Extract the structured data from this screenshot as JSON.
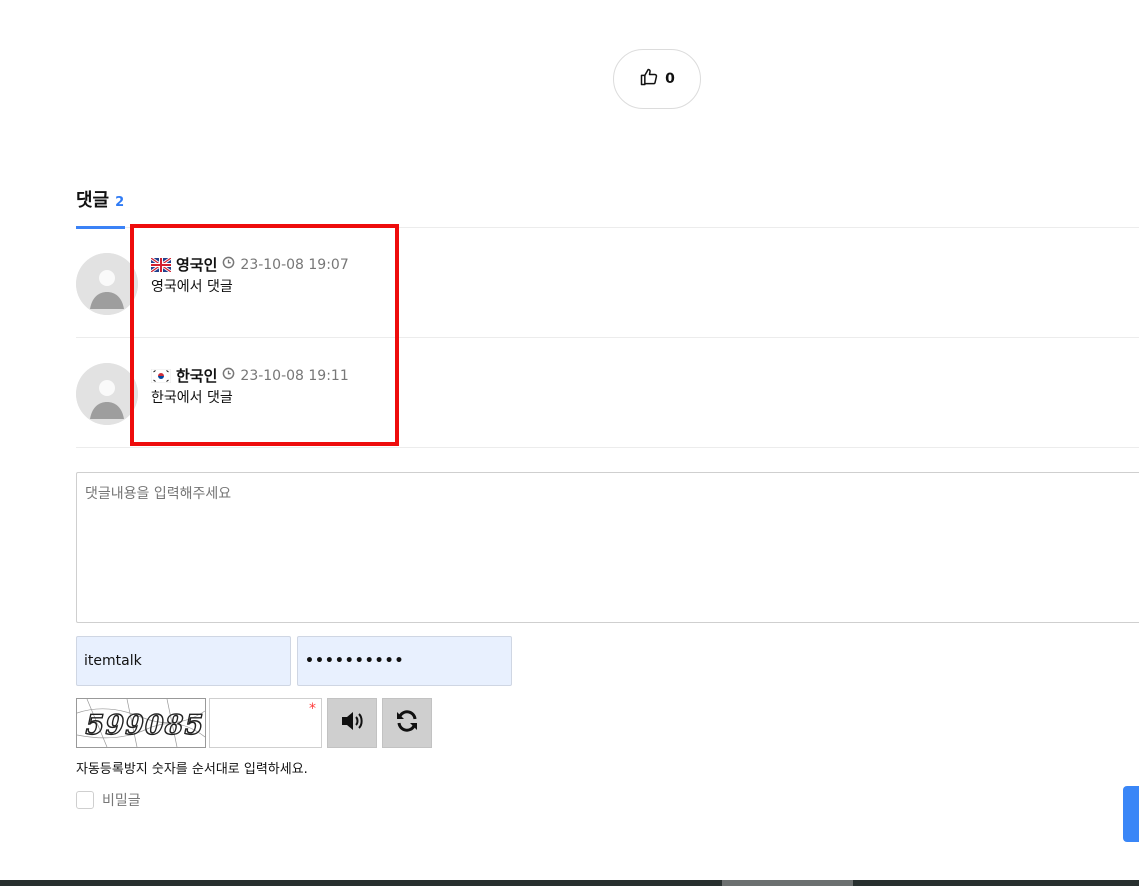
{
  "like": {
    "icon": "thumbs-up-icon",
    "count": "0"
  },
  "comments_section": {
    "title": "댓글",
    "count": "2",
    "accent_color": "#3b82f6",
    "items": [
      {
        "flag": "uk-flag-icon",
        "author": "영국인",
        "datetime": "23-10-08 19:07",
        "text": "영국에서 댓글"
      },
      {
        "flag": "korea-flag-icon",
        "author": "한국인",
        "datetime": "23-10-08 19:11",
        "text": "한국에서 댓글"
      }
    ]
  },
  "highlight_color": "#ee0c0c",
  "form": {
    "comment_placeholder": "댓글내용을 입력해주세요",
    "username_value": "itemtalk",
    "password_mask": "••••••••••",
    "captcha": {
      "image_text": "599085",
      "required_mark": "*",
      "help_text": "자동등록방지 숫자를 순서대로 입력하세요.",
      "audio_icon": "speaker-icon",
      "refresh_icon": "refresh-icon"
    },
    "secret_label": "비밀글"
  }
}
